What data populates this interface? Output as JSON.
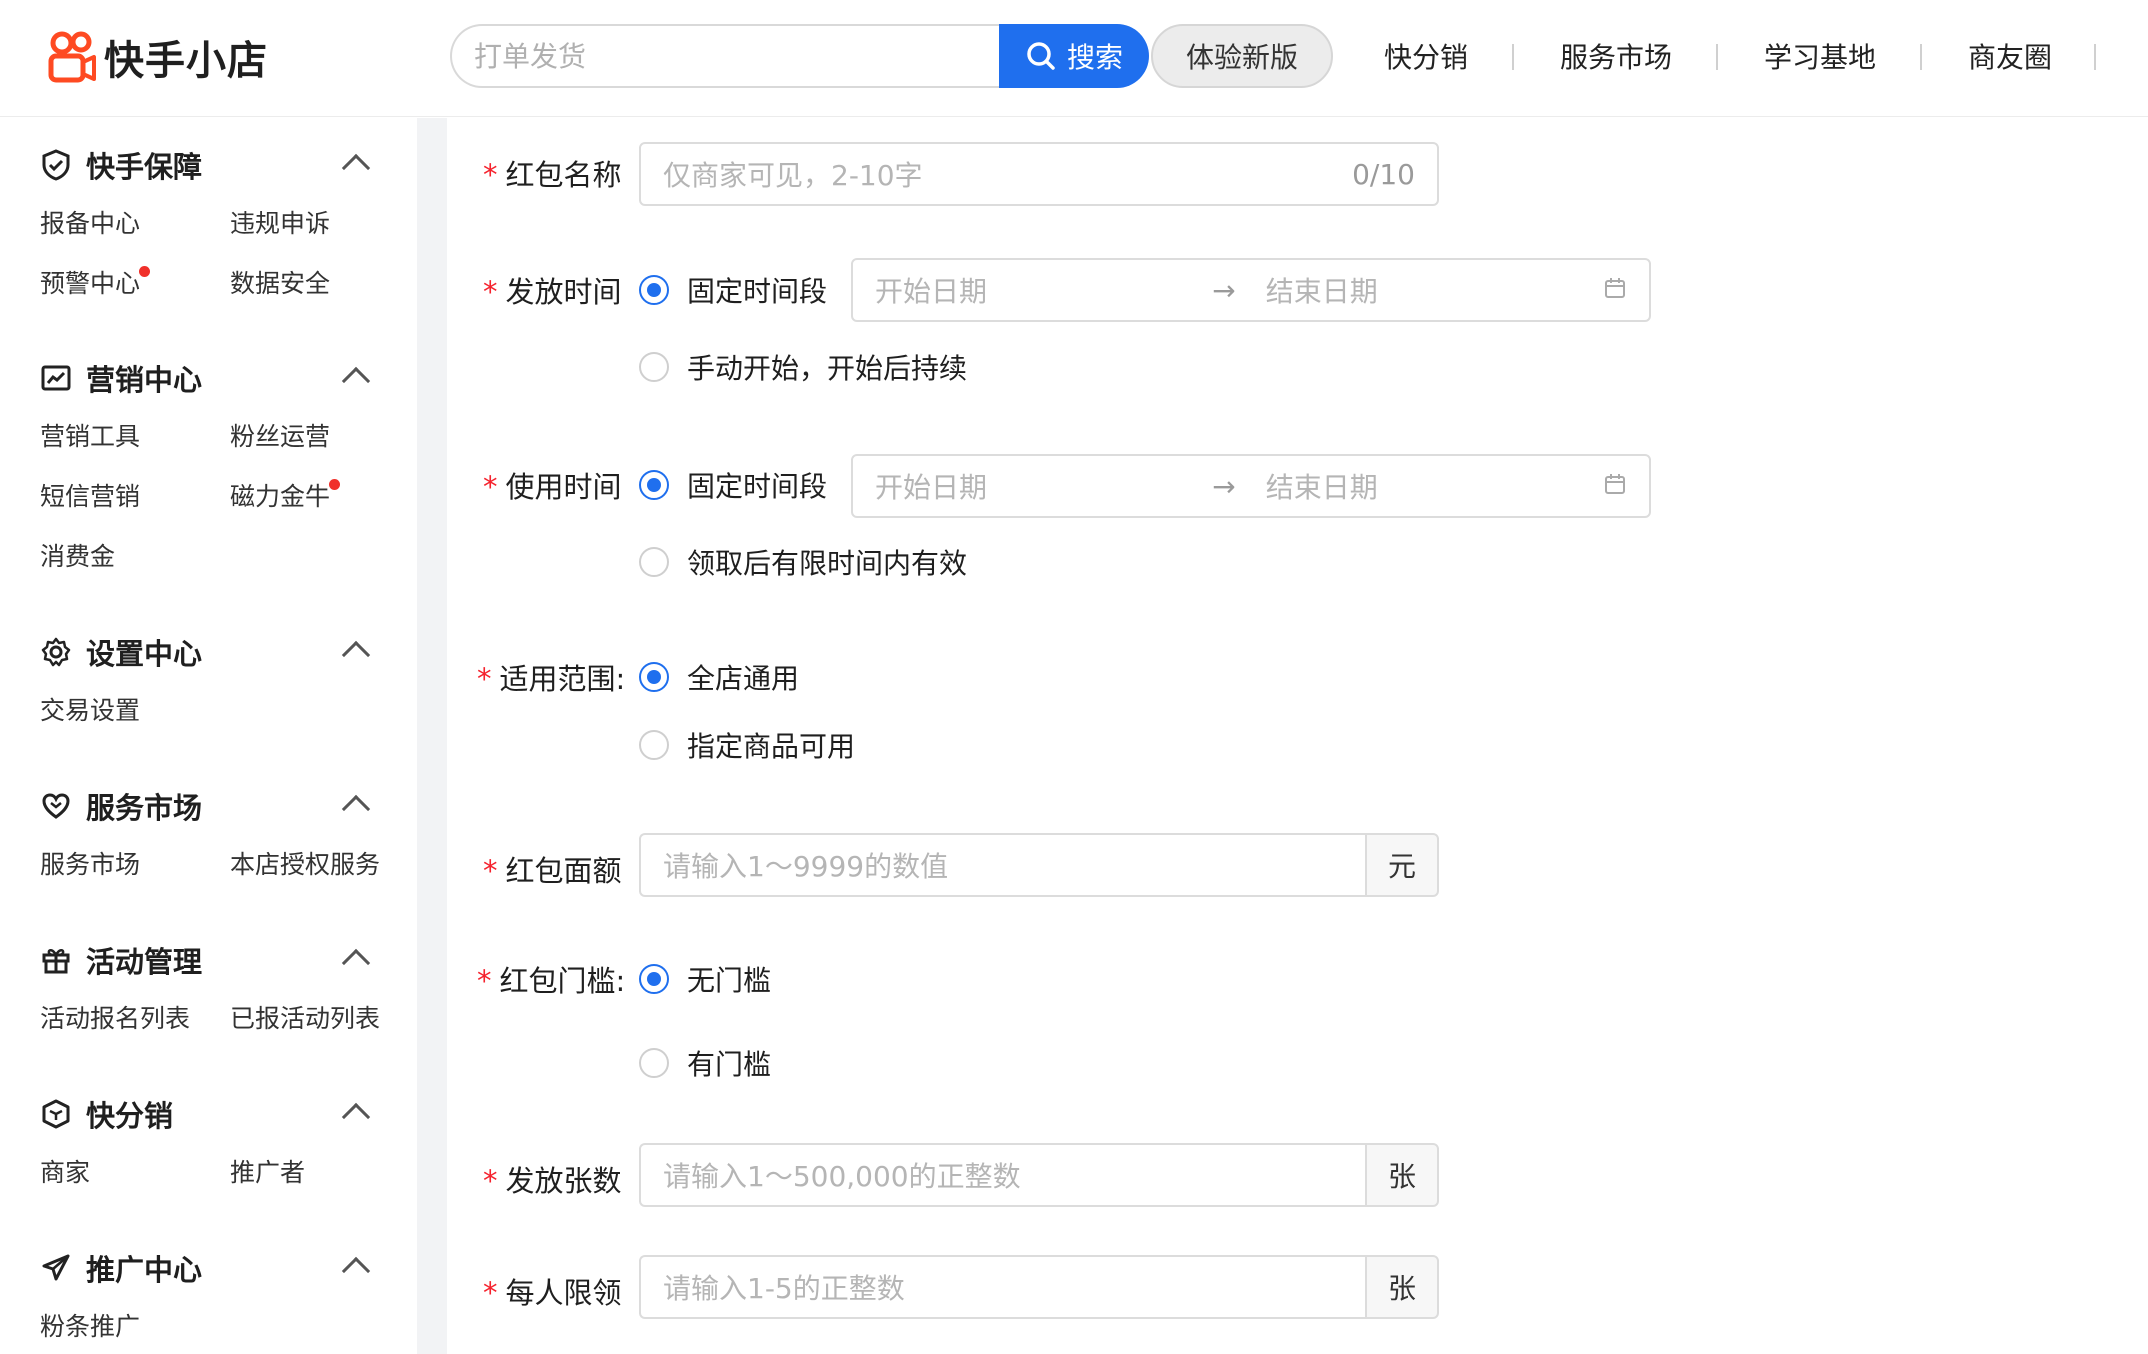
{
  "header": {
    "logo_text": "快手小店",
    "search_placeholder": "打单发货",
    "search_button": "搜索",
    "new_version_button": "体验新版",
    "nav": [
      "快分销",
      "服务市场",
      "学习基地",
      "商友圈"
    ]
  },
  "sidebar": {
    "sections": [
      {
        "title": "快手保障",
        "icon": "shield-icon",
        "items": [
          "报备中心",
          "违规申诉",
          "预警中心",
          "数据安全"
        ]
      },
      {
        "title": "营销中心",
        "icon": "chart-icon",
        "items": [
          "营销工具",
          "粉丝运营",
          "短信营销",
          "磁力金牛",
          "消费金"
        ]
      },
      {
        "title": "设置中心",
        "icon": "gear-icon",
        "items": [
          "交易设置"
        ]
      },
      {
        "title": "服务市场",
        "icon": "heart-icon",
        "items": [
          "服务市场",
          "本店授权服务"
        ]
      },
      {
        "title": "活动管理",
        "icon": "gift-icon",
        "items": [
          "活动报名列表",
          "已报活动列表"
        ]
      },
      {
        "title": "快分销",
        "icon": "cube-icon",
        "items": [
          "商家",
          "推广者"
        ]
      },
      {
        "title": "推广中心",
        "icon": "paper-plane-icon",
        "items": [
          "粉条推广"
        ]
      }
    ],
    "notify_dot_color": "#f0302a"
  },
  "form": {
    "required_mark": "*",
    "name": {
      "label": "红包名称",
      "placeholder": "仅商家可见，2-10字",
      "count": "0/10"
    },
    "issue_time": {
      "label": "发放时间",
      "option_fixed": "固定时间段",
      "option_manual": "手动开始，开始后持续",
      "start": "开始日期",
      "end": "结束日期",
      "arrow": "→"
    },
    "use_time": {
      "label": "使用时间",
      "option_fixed": "固定时间段",
      "option_limited": "领取后有限时间内有效",
      "start": "开始日期",
      "end": "结束日期",
      "arrow": "→"
    },
    "scope": {
      "label": "适用范围:",
      "option_all": "全店通用",
      "option_specified": "指定商品可用"
    },
    "amount": {
      "label": "红包面额",
      "placeholder": "请输入1～9999的数值",
      "unit": "元"
    },
    "threshold": {
      "label": "红包门槛:",
      "option_none": "无门槛",
      "option_has": "有门槛"
    },
    "quantity": {
      "label": "发放张数",
      "placeholder": "请输入1～500,000的正整数",
      "unit": "张"
    },
    "per_user": {
      "label": "每人限领",
      "placeholder": "请输入1-5的正整数",
      "unit": "张"
    }
  },
  "colors": {
    "accent": "#1f6fee",
    "logo": "#fe3666",
    "required": "#f5222d"
  }
}
